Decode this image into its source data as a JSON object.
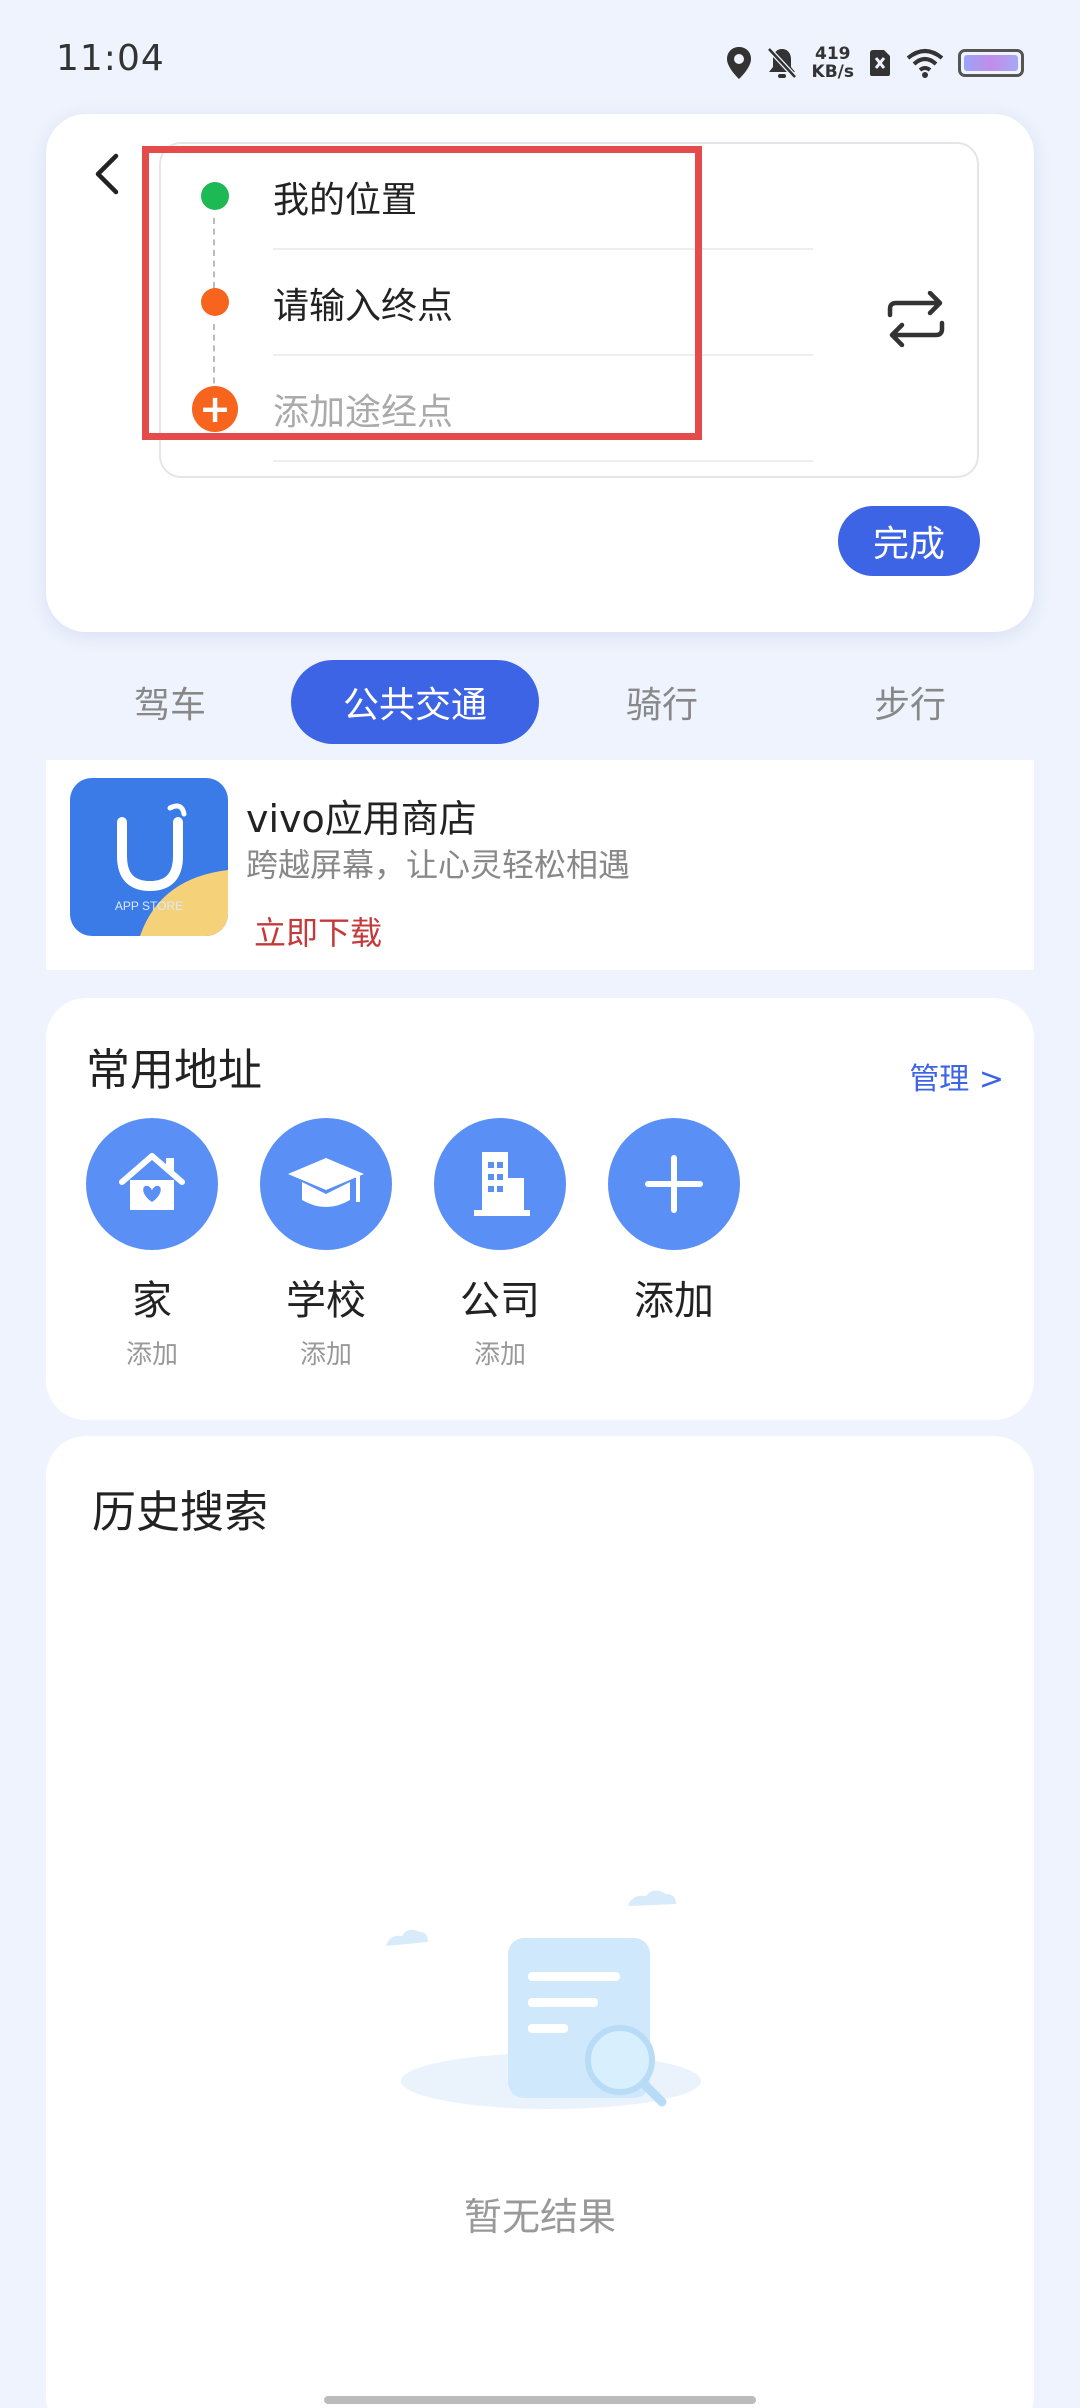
{
  "status_bar": {
    "time": "11:04",
    "net_speed_value": "419",
    "net_speed_unit": "KB/s"
  },
  "route": {
    "origin": "我的位置",
    "destination_placeholder": "请输入终点",
    "add_waypoint_placeholder": "添加途经点",
    "done_label": "完成",
    "origin_color": "#1db954",
    "destination_color": "#f7641e"
  },
  "modes": [
    {
      "label": "驾车",
      "active": false
    },
    {
      "label": "公共交通",
      "active": true
    },
    {
      "label": "骑行",
      "active": false
    },
    {
      "label": "步行",
      "active": false
    }
  ],
  "ad": {
    "logo_text": "APP STORE",
    "title": "vivo应用商店",
    "subtitle": "跨越屏幕，让心灵轻松相遇",
    "cta": "立即下载"
  },
  "favorites": {
    "title": "常用地址",
    "manage_label": "管理 >",
    "items": [
      {
        "name": "家",
        "sub": "添加",
        "icon": "home-icon"
      },
      {
        "name": "学校",
        "sub": "添加",
        "icon": "graduation-cap-icon"
      },
      {
        "name": "公司",
        "sub": "添加",
        "icon": "building-icon"
      },
      {
        "name": "添加",
        "sub": "",
        "icon": "plus-icon"
      }
    ]
  },
  "history": {
    "title": "历史搜索",
    "empty_text": "暂无结果"
  },
  "colors": {
    "accent": "#3e64e6",
    "background": "#eef3fd",
    "highlight": "#e54b4b"
  }
}
